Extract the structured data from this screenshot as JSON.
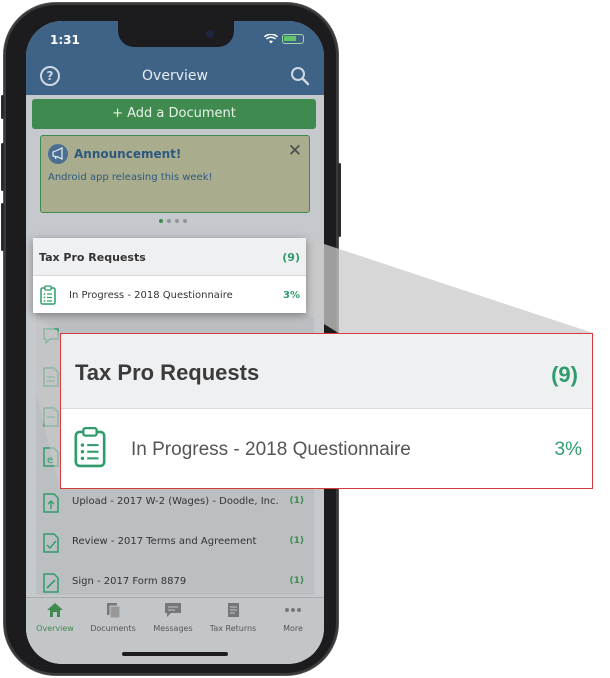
{
  "status_bar": {
    "time": "1:31"
  },
  "nav": {
    "title": "Overview",
    "help_icon": "?"
  },
  "add_document": {
    "label": "+ Add a Document"
  },
  "announcement": {
    "title": "Announcement!",
    "body": "Android app releasing this week!",
    "close_glyph": "✕"
  },
  "tax_pro_requests": {
    "title": "Tax Pro Requests",
    "count": "(9)",
    "first_item": {
      "label": "In Progress - 2018 Questionnaire",
      "progress": "3%"
    }
  },
  "requests": [
    {
      "label": "Upload - 2017 W-2 (Wages) - Doodle, Inc.",
      "count": "(1)",
      "icon": "upload-doc-icon"
    },
    {
      "label": "Review - 2017 Terms and Agreement",
      "count": "(1)",
      "icon": "review-doc-icon"
    },
    {
      "label": "Sign - 2017 Form 8879",
      "count": "(1)",
      "icon": "sign-doc-icon"
    }
  ],
  "tabs": [
    {
      "label": "Overview",
      "icon": "home-icon",
      "active": true
    },
    {
      "label": "Documents",
      "icon": "documents-icon"
    },
    {
      "label": "Messages",
      "icon": "messages-icon"
    },
    {
      "label": "Tax Returns",
      "icon": "tax-returns-icon"
    },
    {
      "label": "More",
      "icon": "more-icon"
    }
  ],
  "colors": {
    "nav_blue": "#3f6387",
    "brand_green": "#3f8a4e",
    "accent_teal": "#2f9c6c",
    "zoom_border": "#d83a3a"
  }
}
